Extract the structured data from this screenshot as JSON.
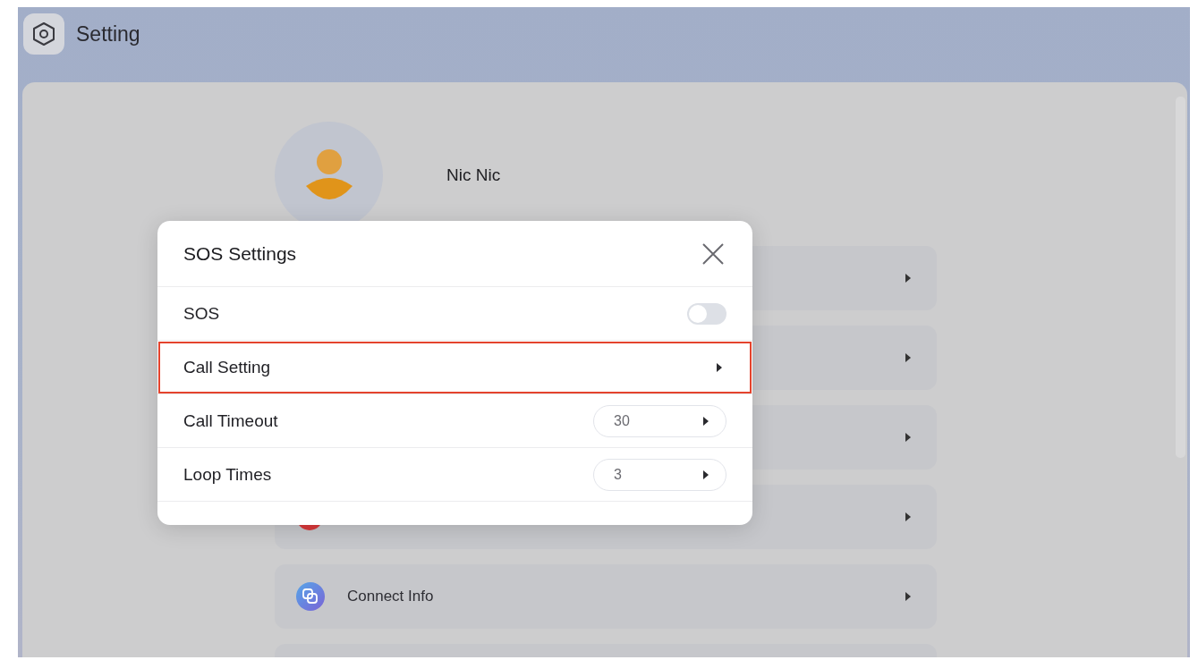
{
  "header": {
    "title": "Setting"
  },
  "profile": {
    "name": "Nic Nic"
  },
  "menu_rows": [
    {
      "kind": "blank"
    },
    {
      "kind": "blank"
    },
    {
      "kind": "blank"
    },
    {
      "kind": "icon"
    },
    {
      "kind": "labeled",
      "label": "Connect Info"
    },
    {
      "kind": "blank"
    }
  ],
  "modal": {
    "title": "SOS Settings",
    "rows": [
      {
        "kind": "toggle",
        "label": "SOS",
        "on": false,
        "highlighted": false
      },
      {
        "kind": "link",
        "label": "Call Setting",
        "highlighted": true
      },
      {
        "kind": "value",
        "label": "Call Timeout",
        "value": "30",
        "highlighted": false
      },
      {
        "kind": "value",
        "label": "Loop Times",
        "value": "3",
        "highlighted": false
      }
    ]
  }
}
